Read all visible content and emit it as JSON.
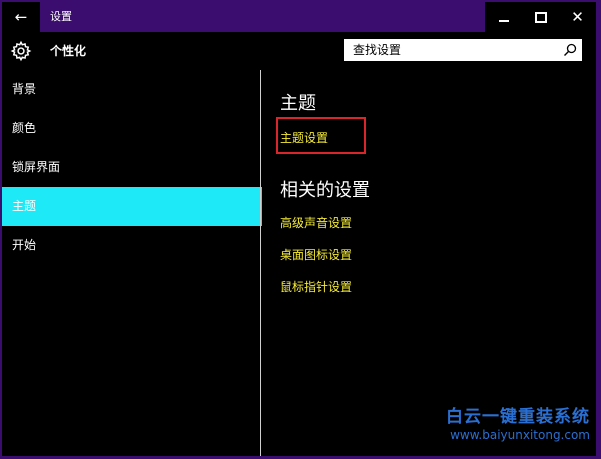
{
  "window": {
    "back_glyph": "←",
    "title": "设置",
    "controls": {
      "minimize": "minimize",
      "maximize": "maximize",
      "close": "✕"
    }
  },
  "header": {
    "title": "个性化",
    "search_placeholder": "查找设置"
  },
  "sidebar": {
    "items": [
      {
        "label": "背景"
      },
      {
        "label": "颜色"
      },
      {
        "label": "锁屏界面"
      },
      {
        "label": "主题",
        "active": true
      },
      {
        "label": "开始"
      }
    ]
  },
  "main": {
    "theme_heading": "主题",
    "theme_settings_link": "主题设置",
    "related_heading": "相关的设置",
    "related_links": [
      "高级声音设置",
      "桌面图标设置",
      "鼠标指针设置"
    ]
  },
  "watermark": {
    "title": "白云一键重装系统",
    "url": "www.baiyunxitong.com"
  },
  "colors": {
    "titlebar": "#3a0d6e",
    "background": "#000000",
    "active_nav": "#1ee9f7",
    "link": "#f5eb37",
    "highlight_border": "#d8262a",
    "watermark": "#2a6fd1"
  },
  "icons": [
    "back-arrow-icon",
    "gear-icon",
    "search-icon",
    "minimize-icon",
    "maximize-icon",
    "close-icon"
  ]
}
